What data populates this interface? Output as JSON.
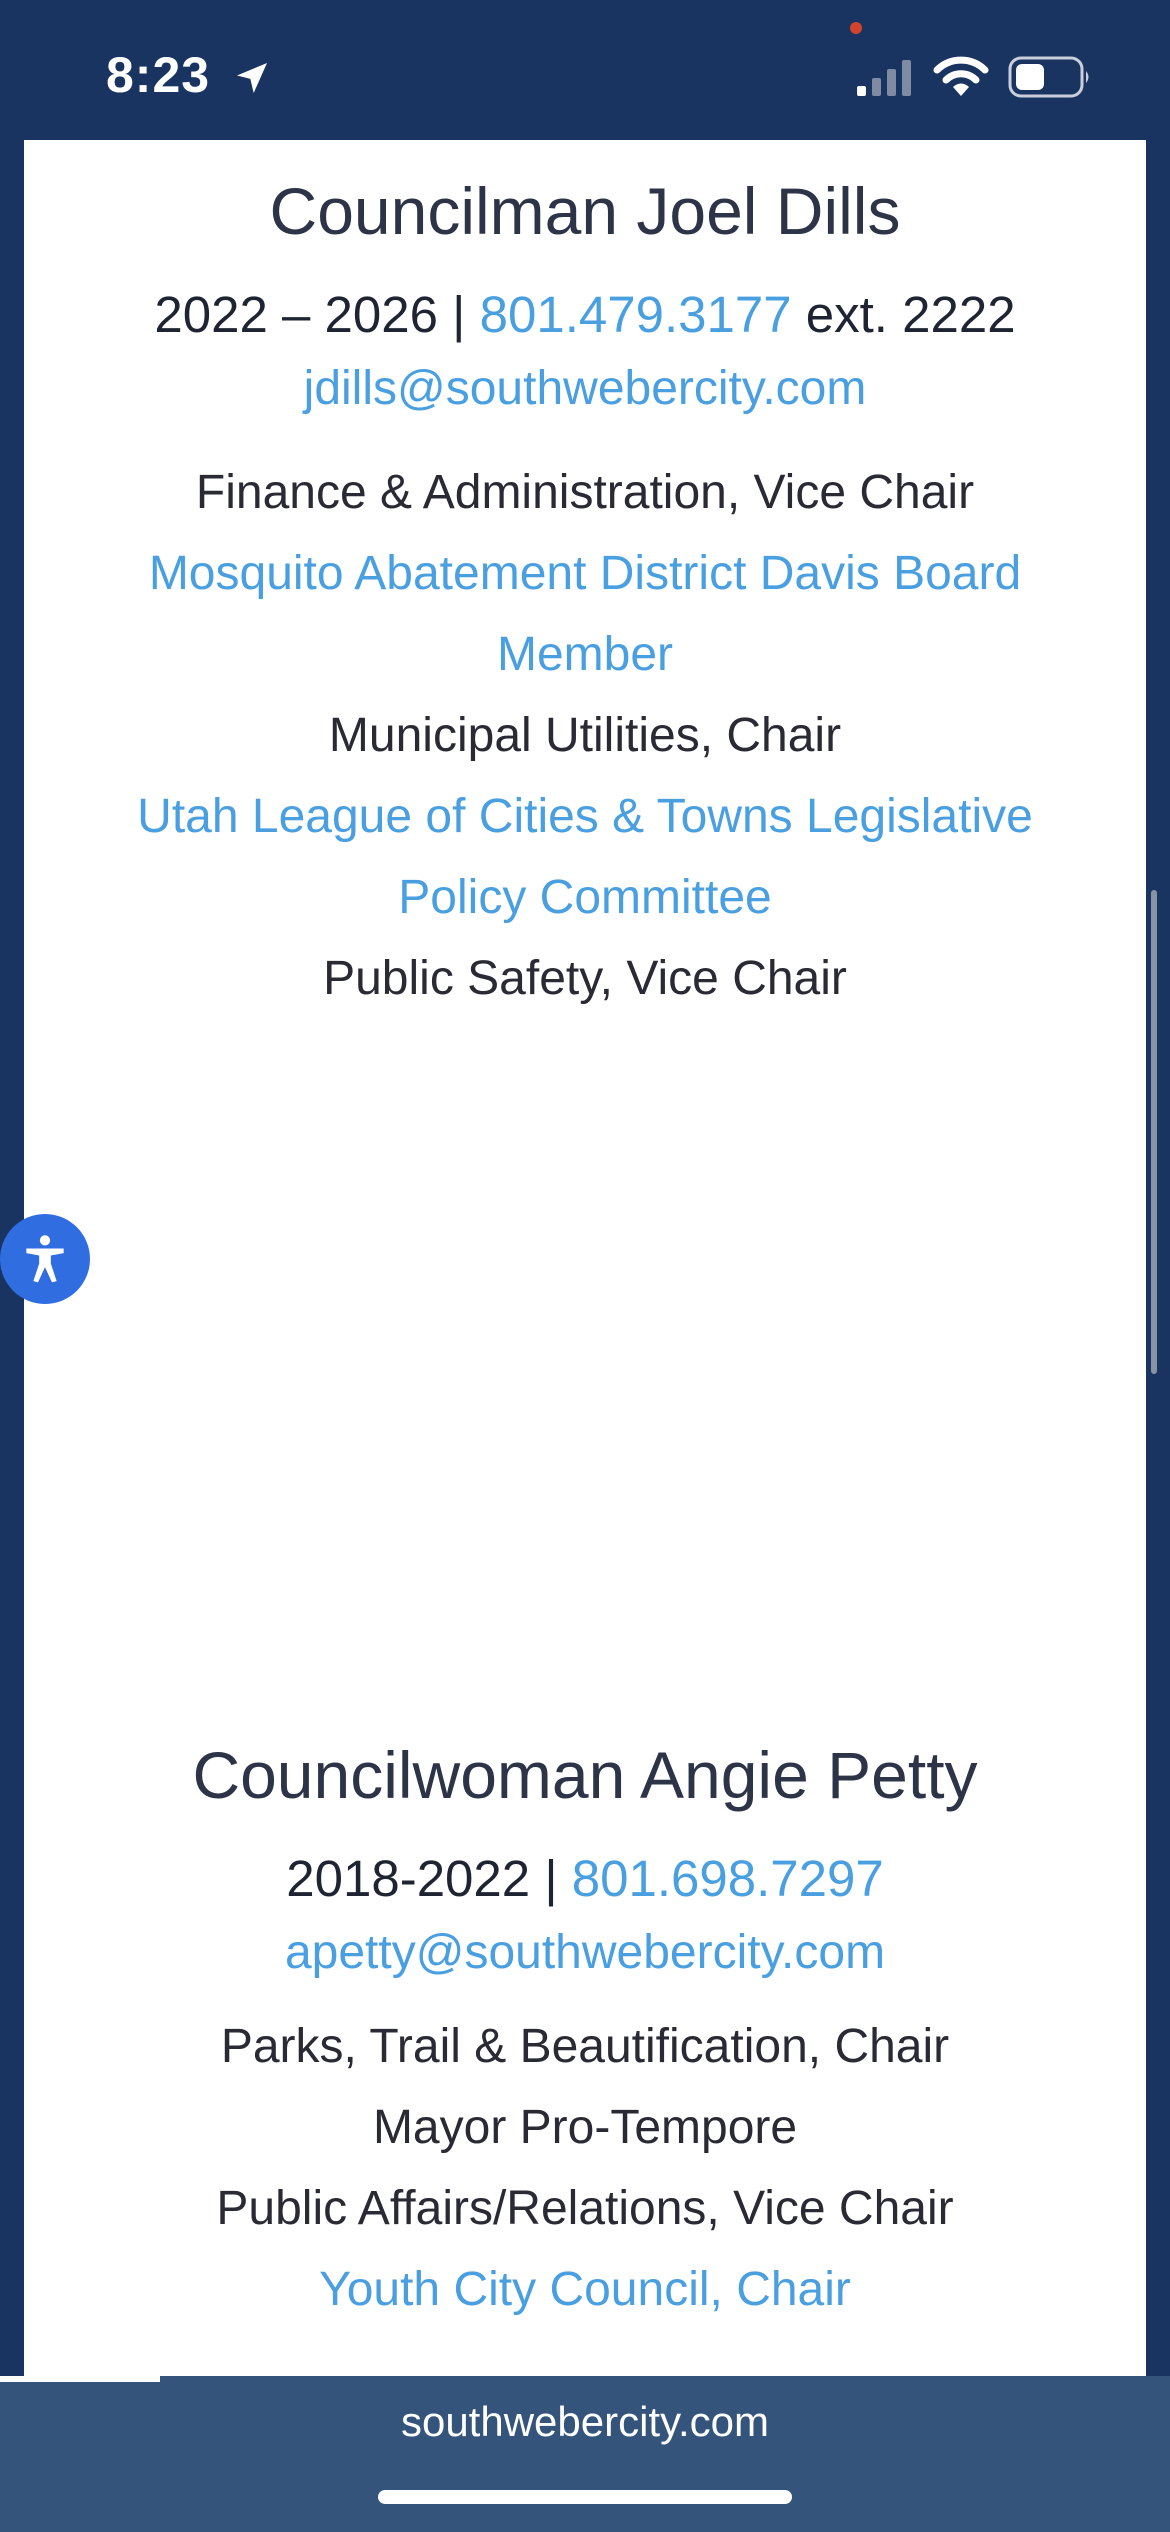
{
  "status_bar": {
    "time": "8:23",
    "icons": [
      "location-arrow-icon",
      "signal-icon",
      "wifi-icon",
      "battery-icon"
    ]
  },
  "members": [
    {
      "name": "Councilman Joel Dills",
      "term": "2022 – 2026",
      "separator": " | ",
      "phone": "801.479.3177",
      "extension": " ext. 2222",
      "email": "jdills@southwebercity.com",
      "duties": [
        {
          "text": "Finance & Administration, Vice Chair",
          "link": false
        },
        {
          "text": "Mosquito Abatement District Davis Board Member",
          "link": true
        },
        {
          "text": "Municipal Utilities, Chair",
          "link": false
        },
        {
          "text": "Utah League of Cities & Towns Legislative Policy Committee",
          "link": true
        },
        {
          "text": "Public Safety, Vice Chair",
          "link": false
        }
      ]
    },
    {
      "name": "Councilwoman Angie Petty",
      "term": "2018-2022",
      "separator": " | ",
      "phone": "801.698.7297",
      "email": "apetty@southwebercity.com",
      "duties": [
        {
          "text": "Parks, Trail & Beautification, Chair",
          "link": false
        },
        {
          "text": "Mayor Pro-Tempore",
          "link": false
        },
        {
          "text": "Public Affairs/Relations, Vice Chair",
          "link": false
        },
        {
          "text": "Youth City Council, Chair",
          "link": true
        }
      ]
    }
  ],
  "accessibility_button": {
    "icon": "accessibility-person-icon"
  },
  "browser": {
    "url": "southwebercity.com"
  },
  "colors": {
    "brand_navy": "#1a3461",
    "link_blue": "#4a9fe0",
    "accessibility_blue": "#2f6de1",
    "browser_bar": "#35547c"
  }
}
